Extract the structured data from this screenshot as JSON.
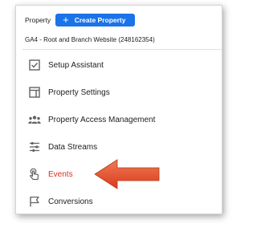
{
  "header": {
    "property_label": "Property",
    "create_button_label": "Create Property",
    "create_button_icon": "plus-icon",
    "property_name": "GA4 - Root and Branch Website (248162354)"
  },
  "menu": {
    "items": [
      {
        "label": "Setup Assistant",
        "icon": "checkbox-icon"
      },
      {
        "label": "Property Settings",
        "icon": "layout-icon"
      },
      {
        "label": "Property Access Management",
        "icon": "people-icon"
      },
      {
        "label": "Data Streams",
        "icon": "streams-icon"
      },
      {
        "label": "Events",
        "icon": "touch-icon",
        "active": true
      },
      {
        "label": "Conversions",
        "icon": "flag-icon"
      }
    ]
  },
  "colors": {
    "accent": "#1a73e8",
    "active_text": "#d93025",
    "arrow": "#e1502f"
  }
}
